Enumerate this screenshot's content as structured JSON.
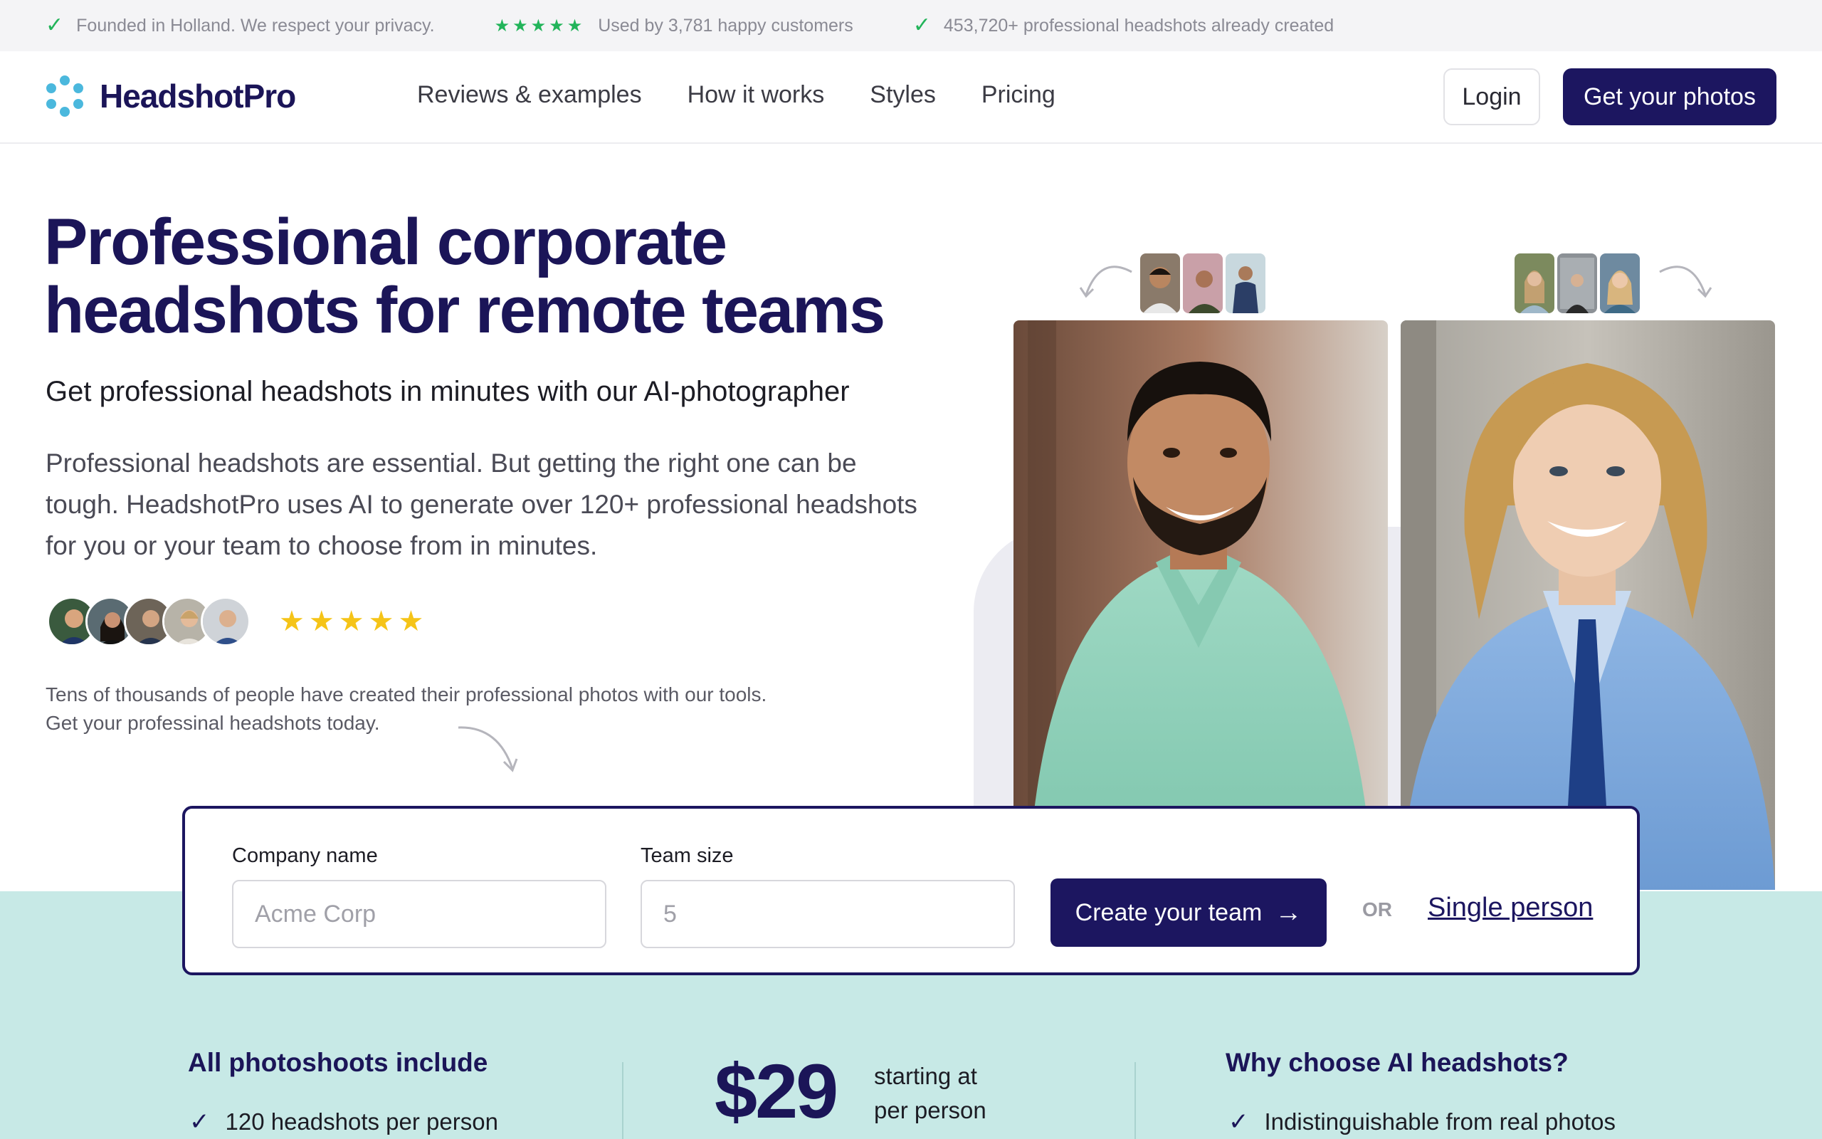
{
  "topbar": {
    "privacy": "Founded in Holland. We respect your privacy.",
    "customers": "Used by 3,781 happy customers",
    "headshots": "453,720+ professional headshots already created"
  },
  "nav": {
    "brand": "HeadshotPro",
    "links": [
      "Reviews & examples",
      "How it works",
      "Styles",
      "Pricing"
    ],
    "login": "Login",
    "cta": "Get your photos"
  },
  "hero": {
    "title_line1": "Professional corporate",
    "title_line2": "headshots for remote teams",
    "subtitle": "Get professional headshots in minutes with our AI-photographer",
    "body": "Professional headshots are essential. But getting the right one can be tough. HeadshotPro uses AI to generate over 120+ professional headshots for you or your team to choose from in minutes.",
    "rating": 5,
    "note": "Tens of thousands of people have created their professional photos with our tools. Get your professinal headshots today."
  },
  "form": {
    "company_label": "Company name",
    "company_placeholder": "Acme Corp",
    "team_label": "Team size",
    "team_placeholder": "5",
    "create_button": "Create your team",
    "or": "OR",
    "single_link": "Single person"
  },
  "features": {
    "includes_title": "All photoshoots include",
    "includes_first": "120 headshots per person",
    "price": "$29",
    "price_note_line1": "starting at",
    "price_note_line2": "per person",
    "why_title": "Why choose AI headshots?",
    "why_first": "Indistinguishable from real photos"
  },
  "colors": {
    "brand_navy": "#1c1660",
    "accent_green": "#22b45a",
    "star_yellow": "#f5c418",
    "teal_band": "#c7e9e6"
  }
}
